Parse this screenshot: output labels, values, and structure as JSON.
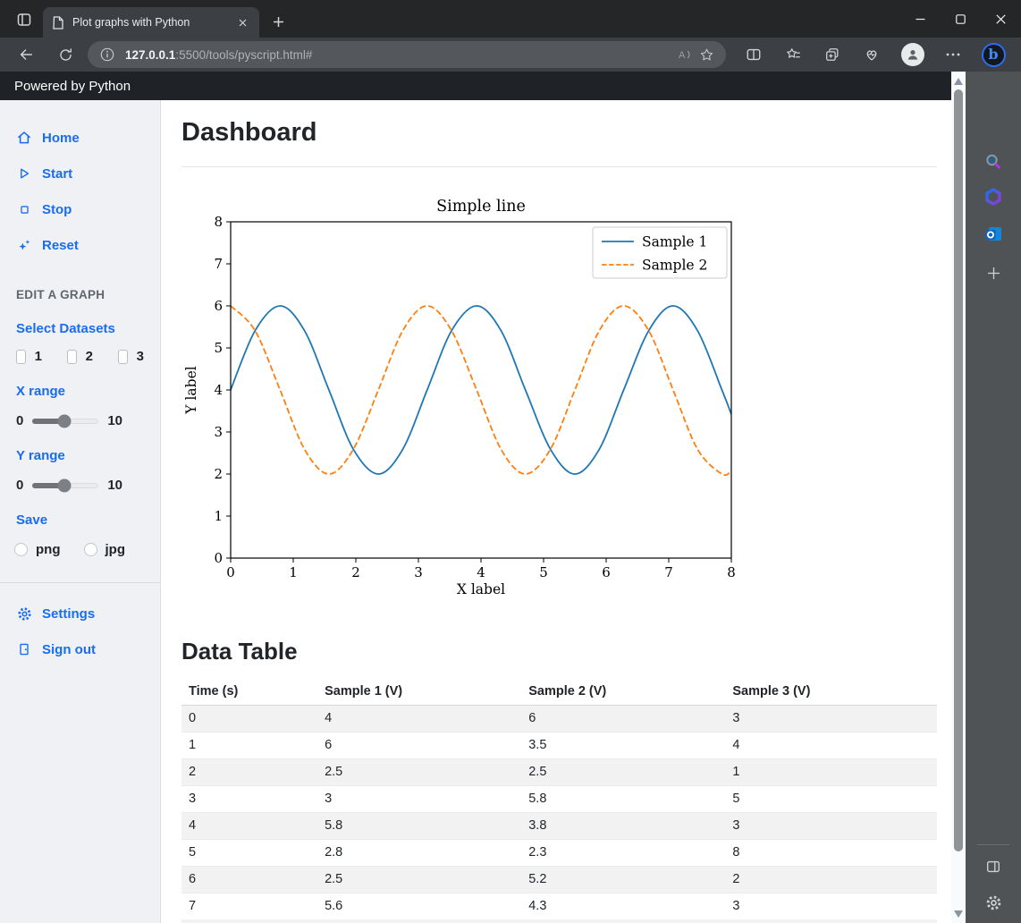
{
  "browser": {
    "tab_title": "Plot graphs with Python",
    "url": {
      "host": "127.0.0.1",
      "rest": ":5500/tools/pyscript.html#"
    },
    "window_controls": [
      "minimize",
      "maximize",
      "close"
    ],
    "toolbar_icons": [
      "back",
      "refresh",
      "info",
      "read-aloud",
      "favorite-star",
      "split-screen",
      "favorites-list",
      "collections",
      "browser-essentials",
      "profile-avatar",
      "more-options",
      "copilot"
    ]
  },
  "app_bar": {
    "label": "Powered by Python"
  },
  "left_nav": {
    "items": [
      {
        "label": "Home",
        "icon": "home-icon"
      },
      {
        "label": "Start",
        "icon": "play-icon"
      },
      {
        "label": "Stop",
        "icon": "stop-icon"
      },
      {
        "label": "Reset",
        "icon": "sparkle-icon"
      }
    ],
    "section_title": "EDIT A GRAPH",
    "select_datasets_label": "Select Datasets",
    "dataset_options": [
      {
        "label": "1",
        "checked": false
      },
      {
        "label": "2",
        "checked": false
      },
      {
        "label": "3",
        "checked": false
      }
    ],
    "x_range": {
      "label": "X range",
      "min_label": "0",
      "max_label": "10",
      "value_percent": 48
    },
    "y_range": {
      "label": "Y range",
      "min_label": "0",
      "max_label": "10",
      "value_percent": 48
    },
    "save_label": "Save",
    "save_formats": [
      {
        "label": "png",
        "selected": false
      },
      {
        "label": "jpg",
        "selected": false
      }
    ],
    "footer_items": [
      {
        "label": "Settings",
        "icon": "gear-icon"
      },
      {
        "label": "Sign out",
        "icon": "sign-out-icon"
      }
    ]
  },
  "main": {
    "heading": "Dashboard",
    "table_heading": "Data Table",
    "table": {
      "columns": [
        "Time (s)",
        "Sample 1 (V)",
        "Sample 2 (V)",
        "Sample 3 (V)"
      ],
      "rows": [
        [
          "0",
          "4",
          "6",
          "3"
        ],
        [
          "1",
          "6",
          "3.5",
          "4"
        ],
        [
          "2",
          "2.5",
          "2.5",
          "1"
        ],
        [
          "3",
          "3",
          "5.8",
          "5"
        ],
        [
          "4",
          "5.8",
          "3.8",
          "3"
        ],
        [
          "5",
          "2.8",
          "2.3",
          "8"
        ],
        [
          "6",
          "2.5",
          "5.2",
          "2"
        ],
        [
          "7",
          "5.6",
          "4.3",
          "3"
        ]
      ]
    }
  },
  "chart_data": {
    "type": "line",
    "title": "Simple line",
    "xlabel": "X label",
    "ylabel": "Y label",
    "xlim": [
      0,
      8
    ],
    "ylim": [
      0,
      8
    ],
    "xticks": [
      0,
      1,
      2,
      3,
      4,
      5,
      6,
      7,
      8
    ],
    "yticks": [
      0,
      1,
      2,
      3,
      4,
      5,
      6,
      7,
      8
    ],
    "grid": false,
    "legend_position": "upper right",
    "x": [
      0,
      0.39,
      0.79,
      1.18,
      1.57,
      1.96,
      2.36,
      2.75,
      3.14,
      3.53,
      3.93,
      4.32,
      4.71,
      5.11,
      5.5,
      5.89,
      6.28,
      6.68,
      7.07,
      7.46,
      7.85,
      8
    ],
    "series": [
      {
        "name": "Sample 1",
        "color": "#1f77b4",
        "style": "solid",
        "values": [
          4,
          5.41,
          6,
          5.41,
          4,
          2.59,
          2,
          2.59,
          4,
          5.41,
          6,
          5.41,
          4,
          2.59,
          2,
          2.59,
          4,
          5.41,
          6,
          5.41,
          4,
          3.42
        ]
      },
      {
        "name": "Sample 2",
        "color": "#ff7f0e",
        "style": "dashed",
        "values": [
          6,
          5.41,
          4,
          2.59,
          2,
          2.59,
          4,
          5.41,
          6,
          5.41,
          4,
          2.59,
          2,
          2.59,
          4,
          5.41,
          6,
          5.41,
          4,
          2.59,
          2,
          2.08
        ]
      }
    ]
  },
  "edge_sidebar": {
    "items": [
      "search",
      "microsoft-365",
      "outlook",
      "add"
    ],
    "footer_items": [
      "sidebar-toggle",
      "settings"
    ]
  }
}
